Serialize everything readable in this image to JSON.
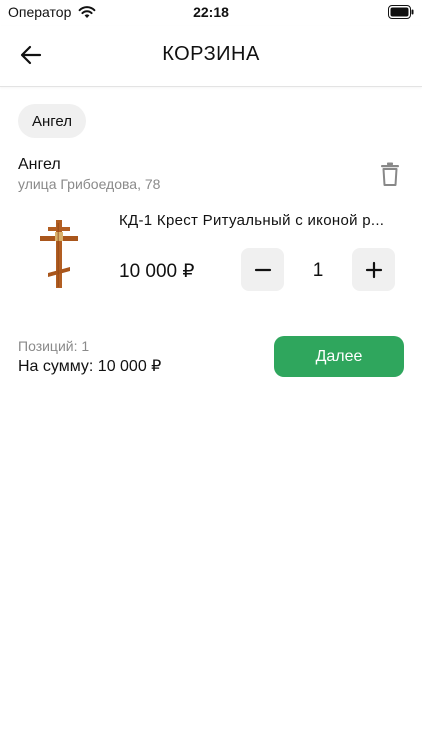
{
  "status_bar": {
    "carrier": "Оператор",
    "time": "22:18"
  },
  "header": {
    "title": "КОРЗИНА",
    "back_icon": "arrow-left-icon"
  },
  "chip": {
    "label": "Ангел"
  },
  "store": {
    "name": "Ангел",
    "address": "улица Грибоедова, 78",
    "delete_icon": "trash-icon"
  },
  "product": {
    "title": "КД-1 Крест Ритуальный с иконой р...",
    "price": "10 000 ₽",
    "quantity": "1",
    "image_icon": "orthodox-cross-icon"
  },
  "summary": {
    "positions": "Позиций: 1",
    "total": "На сумму: 10 000 ₽"
  },
  "actions": {
    "next_label": "Далее"
  },
  "colors": {
    "accent": "#2fa65d",
    "chip_bg": "#f0f0f0",
    "muted_text": "#8a8a8a"
  }
}
